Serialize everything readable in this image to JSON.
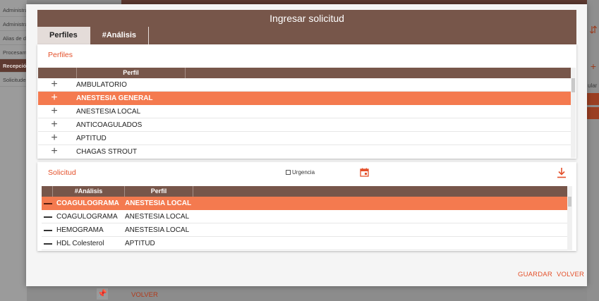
{
  "background": {
    "sidebar_items": [
      "Administra",
      "Administra",
      "Alias de d",
      "Procesami",
      "Recepción",
      "Solicitudes"
    ],
    "active_index": 4,
    "right_partial_text": "ular",
    "volver_label": "VOLVER"
  },
  "modal": {
    "title": "Ingresar solicitud",
    "tabs": [
      {
        "label": "Perfiles",
        "active": true
      },
      {
        "label": "#Análisis",
        "active": false
      }
    ],
    "perfiles": {
      "section_title": "Perfiles",
      "column_header": "Perfil",
      "rows": [
        {
          "name": "AMBULATORIO",
          "selected": false
        },
        {
          "name": "ANESTESIA GENERAL",
          "selected": true
        },
        {
          "name": "ANESTESIA LOCAL",
          "selected": false
        },
        {
          "name": "ANTICOAGULADOS",
          "selected": false
        },
        {
          "name": "APTITUD",
          "selected": false
        },
        {
          "name": "CHAGAS STROUT",
          "selected": false
        }
      ]
    },
    "solicitud": {
      "section_title": "Solicitud",
      "urgencia_label": "Urgencia",
      "urgencia_checked": false,
      "columns": [
        "#Análisis",
        "Perfil"
      ],
      "rows": [
        {
          "analisis": "COAGULOGRAMA",
          "perfil": "ANESTESIA LOCAL",
          "selected": true
        },
        {
          "analisis": "COAGULOGRAMA",
          "perfil": "ANESTESIA LOCAL",
          "selected": false
        },
        {
          "analisis": "HEMOGRAMA",
          "perfil": "ANESTESIA LOCAL",
          "selected": false
        },
        {
          "analisis": "HDL Colesterol",
          "perfil": "APTITUD",
          "selected": false
        }
      ]
    },
    "footer": {
      "save_label": "GUARDAR",
      "cancel_label": "VOLVER"
    }
  },
  "colors": {
    "brown": "#77564a",
    "accent": "#f47a4f",
    "accent_text": "#e4502a"
  }
}
